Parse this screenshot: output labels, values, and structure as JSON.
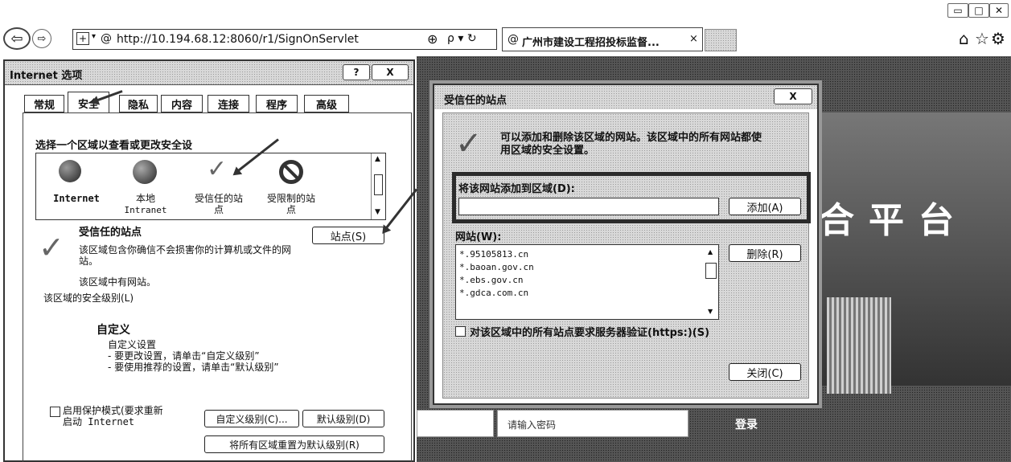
{
  "browser": {
    "url": "http://10.194.68.12:8060/r1/SignOnServlet",
    "tab_title": "广州市建设工程招投标监督...",
    "tab_close": "×",
    "search_glyph": "ρ ▾ ↻",
    "compat_glyph": "⊕",
    "window_buttons": {
      "minimize": "▭",
      "maximize": "□",
      "close": "✕"
    },
    "toolbar_icons": {
      "home": "⌂",
      "favorites": "☆",
      "tools": "⚙"
    }
  },
  "internet_options": {
    "title": "Internet 选项",
    "help_label": "?",
    "close_label": "X",
    "tabs": [
      "常规",
      "安全",
      "隐私",
      "内容",
      "连接",
      "程序",
      "高级"
    ],
    "zone_prompt": "选择一个区域以查看或更改安全设",
    "zones": [
      {
        "label": "Internet",
        "sub": ""
      },
      {
        "label": "本地",
        "sub": "Intranet"
      },
      {
        "label": "受信任的站",
        "sub": "点"
      },
      {
        "label": "受限制的站",
        "sub": "点"
      }
    ],
    "selected_zone_title": "受信任的站点",
    "sites_button": "站点(S)",
    "zone_desc": "该区域包含你确信不会损害你的计算机或文件的网站。",
    "zone_has_sites": "该区域中有网站。",
    "security_level_label": "该区域的安全级别(L)",
    "custom_heading": "自定义",
    "custom_lines": [
      "自定义设置",
      "- 要更改设置，请单击“自定义级别”",
      "- 要使用推荐的设置，请单击“默认级别”"
    ],
    "protected_mode_line1": "启用保护模式(要求重新",
    "protected_mode_line2": "启动 Internet",
    "custom_level_button": "自定义级别(C)...",
    "default_level_button": "默认级别(D)",
    "reset_all_button": "将所有区域重置为默认级别(R)"
  },
  "trusted_sites": {
    "title": "受信任的站点",
    "close_label": "X",
    "info_line1": "可以添加和删除该区域的网站。该区域中的所有网站都使",
    "info_line2": "用区域的安全设置。",
    "add_label": "将该网站添加到区域(D):",
    "add_input_value": "",
    "add_button": "添加(A)",
    "websites_label": "网站(W):",
    "websites": [
      "*.95105813.cn",
      "*.baoan.gov.cn",
      "*.ebs.gov.cn",
      "*.gdca.com.cn"
    ],
    "remove_button": "删除(R)",
    "require_https_label": "对该区域中的所有站点要求服务器验证(https:)(S)",
    "close_button": "关闭(C)"
  },
  "background_page": {
    "heading_partial": "合平台",
    "password_placeholder": "请输入密码",
    "login_label": "登录"
  },
  "colors": {
    "accent_box": "#2b2b2b",
    "background_page": "#4a4a4a"
  }
}
